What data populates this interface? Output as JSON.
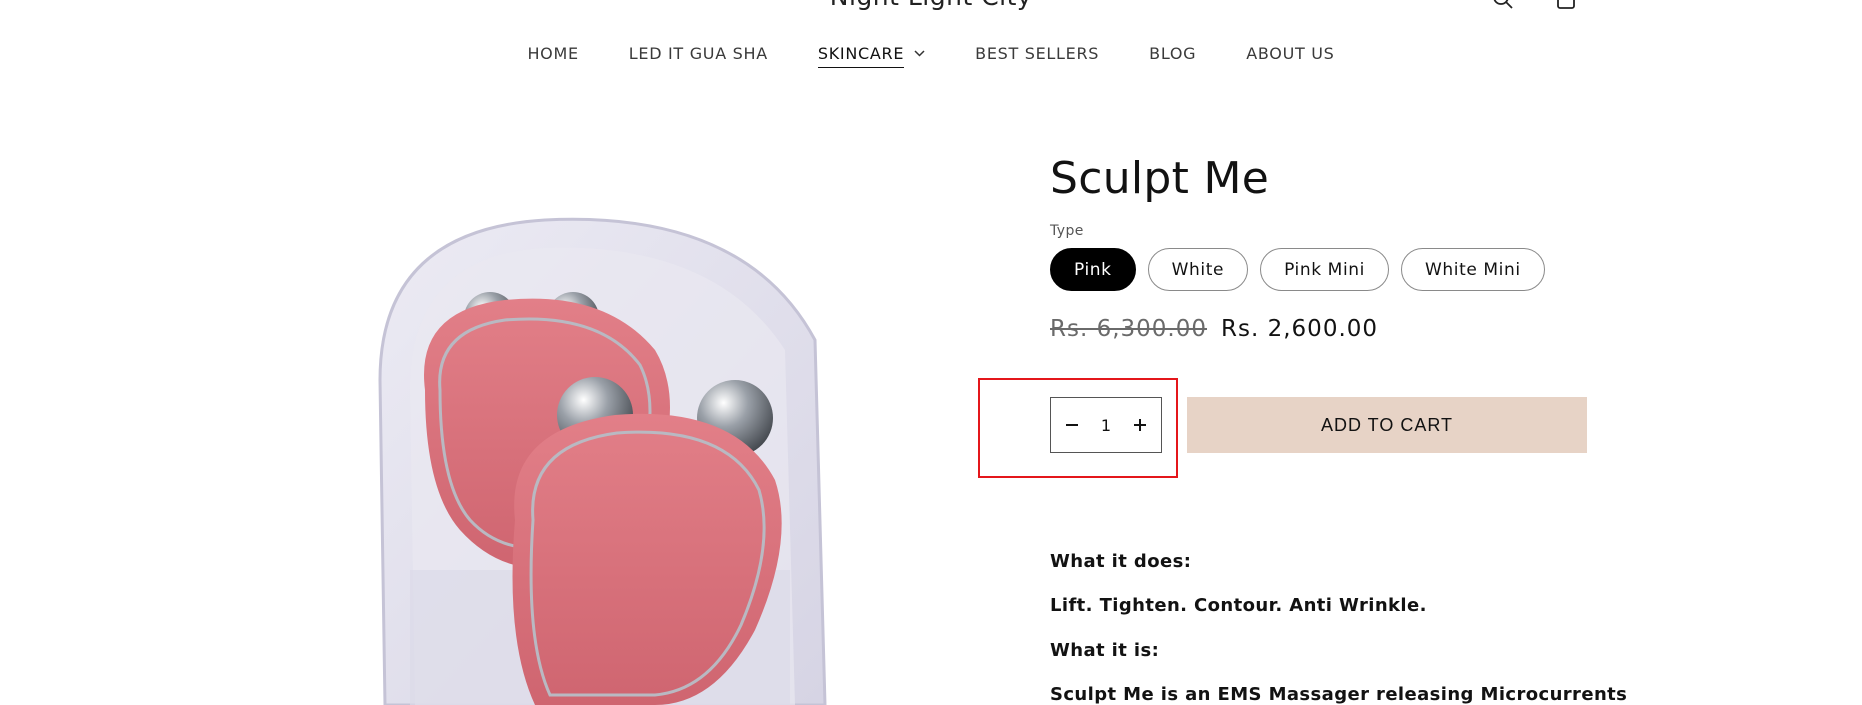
{
  "header": {
    "brand": "Night Light City",
    "icons": [
      "search-icon",
      "cart-icon"
    ]
  },
  "nav": {
    "items": [
      {
        "label": "HOME"
      },
      {
        "label": "LED IT GUA SHA"
      },
      {
        "label": "SKINCARE"
      },
      {
        "label": "BEST SELLERS"
      },
      {
        "label": "BLOG"
      },
      {
        "label": "ABOUT US"
      }
    ],
    "active": "SKINCARE"
  },
  "product": {
    "title": "Sculpt Me",
    "variant_label": "Type",
    "variants": [
      {
        "label": "Pink"
      },
      {
        "label": "White"
      },
      {
        "label": "Pink Mini"
      },
      {
        "label": "White Mini"
      }
    ],
    "selected_variant": "Pink",
    "price_compare": "Rs. 6,300.00",
    "price_sale": "Rs. 2,600.00",
    "quantity": "1",
    "add_to_cart": "ADD TO CART",
    "description": [
      "What it does:",
      "Lift. Tighten. Contour. Anti Wrinkle.",
      "What it is:",
      "Sculpt Me is an EMS Massager releasing Microcurrents"
    ]
  },
  "colors": {
    "accent_button": "#e7d3c6",
    "selected_pill": "#000000",
    "highlight_box": "#e4161b",
    "device_pink": "#e07a84"
  }
}
